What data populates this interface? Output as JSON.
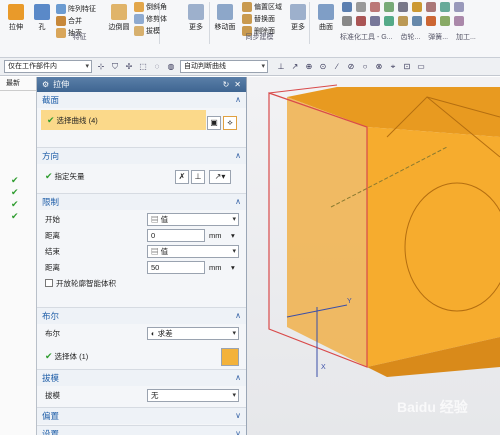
{
  "ribbon": {
    "extrude_label": "拉伸",
    "hole_label": "孔",
    "pattern_label": "阵列特征",
    "combine_label": "合并",
    "shell_label": "抽壳",
    "feature_group_label": "特征",
    "edge_blend_label": "边倒圆",
    "chamfer_label": "倒斜角",
    "trim_label": "修剪体",
    "draft_label": "拔模",
    "more1_label": "更多",
    "move_face_label": "移动面",
    "offset_region_label": "偏置区域",
    "replace_face_label": "替换面",
    "delete_face_label": "删除面",
    "more2_label": "更多",
    "sync_group_label": "同步建模",
    "surface_label": "曲面",
    "std_tools_label": "标准化工具 - G...",
    "gear_label": "齿轮...",
    "spring_label": "弹簧...",
    "machining_label": "加工..."
  },
  "toolbar2": {
    "filter_select": "仅在工作部件内",
    "curve_rule_select": "自动判断曲线"
  },
  "nav": {
    "header": "最新"
  },
  "dialog": {
    "title": "拉伸",
    "section_curve": {
      "title": "截面",
      "select_curve_label": "选择曲线 (4)"
    },
    "section_direction": {
      "title": "方向",
      "vector_label": "指定矢量"
    },
    "section_limits": {
      "title": "限制",
      "start_label": "开始",
      "start_value": "值",
      "distance1_label": "距离",
      "distance1_value": "0",
      "distance1_unit": "mm",
      "end_label": "结束",
      "end_value": "值",
      "distance2_label": "距离",
      "distance2_value": "50",
      "distance2_unit": "mm",
      "open_profile_label": "开放轮廓智能体积"
    },
    "section_boolean": {
      "title": "布尔",
      "boolean_label": "布尔",
      "boolean_value": "求差",
      "select_body_label": "选择体 (1)"
    },
    "section_draft": {
      "title": "拔模",
      "draft_label": "拔模",
      "draft_value": "无"
    },
    "section_offset": {
      "title": "偏置"
    },
    "section_settings": {
      "title": "设置"
    }
  },
  "viewport": {
    "axis_x_label": "X",
    "axis_y_label": "Y",
    "body_color": "#f6ac2e",
    "edge_color": "#d94a4a"
  },
  "watermark_text": "Baidu 经验"
}
